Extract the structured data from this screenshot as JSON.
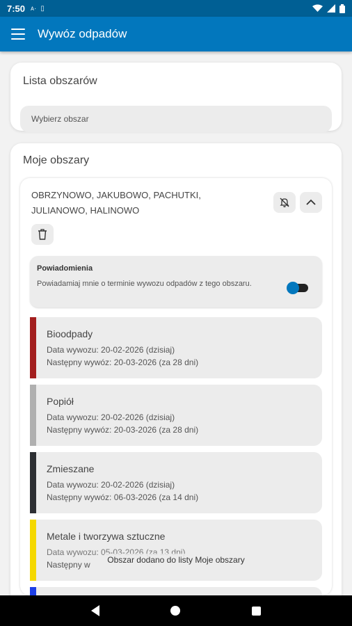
{
  "status": {
    "time": "7:50",
    "indicators": [
      "ᴀ·",
      "▯"
    ],
    "icons": [
      "wifi-icon",
      "signal-icon",
      "battery-icon"
    ]
  },
  "appbar": {
    "title": "Wywóz odpadów",
    "menu_icon": "hamburger-menu-icon",
    "color": "#0277bd"
  },
  "area_list": {
    "title": "Lista obszarów",
    "select_placeholder": "Wybierz obszar"
  },
  "my_areas": {
    "title": "Moje obszary",
    "area": {
      "name": "OBRZYNOWO, JAKUBOWO, PACHUTKI, JULIANOWO, HALINOWO",
      "icons": [
        "bell-off-icon",
        "chevron-up-icon",
        "trash-icon"
      ],
      "notifications": {
        "title": "Powiadomienia",
        "description": "Powiadamiaj mnie o terminie wywozu odpadów z tego obszaru.",
        "enabled": true
      },
      "waste": [
        {
          "name": "Bioodpady",
          "collection": "Data wywozu: 20-02-2026 (dzisiaj)",
          "next": "Następny wywóz: 20-03-2026 (za 28 dni)",
          "color": "#a31f1f"
        },
        {
          "name": "Popiół",
          "collection": "Data wywozu: 20-02-2026 (dzisiaj)",
          "next": "Następny wywóz: 20-03-2026 (za 28 dni)",
          "color": "#b0b0b0"
        },
        {
          "name": "Zmieszane",
          "collection": "Data wywozu: 20-02-2026 (dzisiaj)",
          "next": "Następny wywóz: 06-03-2026 (za 14 dni)",
          "color": "#2d2f33"
        },
        {
          "name": "Metale i tworzywa sztuczne",
          "collection": "Data wywozu: 05-03-2026 (za 13 dni)",
          "next": "Następny w",
          "color": "#f5d800"
        },
        {
          "name": "",
          "collection": "",
          "next": "",
          "color": "#1d3fe6"
        }
      ]
    }
  },
  "snackbar": {
    "message": "Obszar dodano do listy Moje obszary"
  },
  "navbar": {
    "icons": [
      "back-icon",
      "home-icon",
      "recents-icon"
    ]
  }
}
